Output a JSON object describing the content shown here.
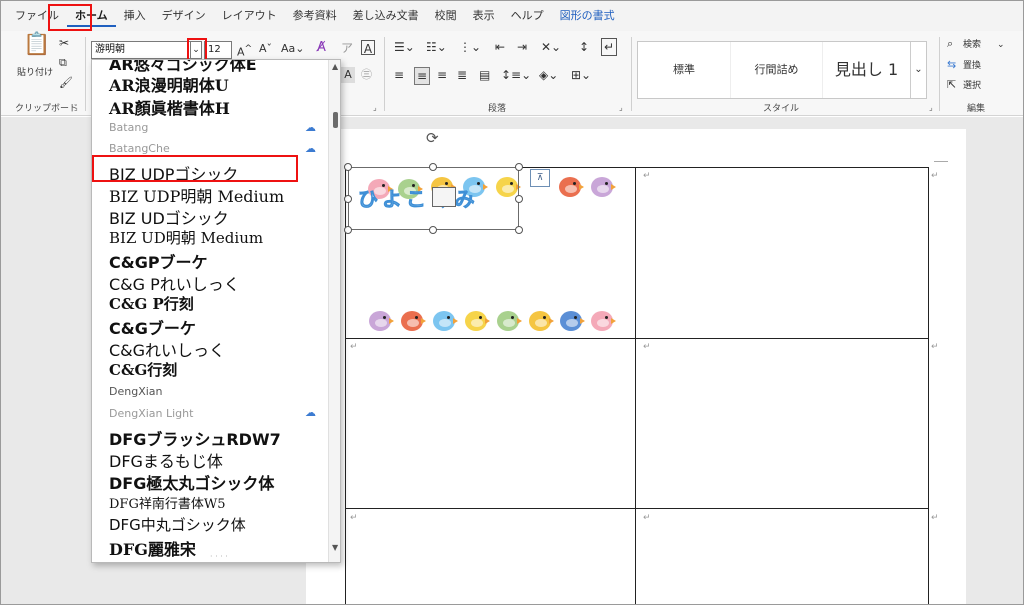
{
  "tabs": [
    "ファイル",
    "ホーム",
    "挿入",
    "デザイン",
    "レイアウト",
    "参考資料",
    "差し込み文書",
    "校閲",
    "表示",
    "ヘルプ",
    "図形の書式"
  ],
  "clipboard": {
    "paste_label": "貼り付け",
    "group_label": "クリップボード"
  },
  "font": {
    "name": "游明朝",
    "size": "12",
    "dropdown_arrow": "⌄"
  },
  "paragraph": {
    "group_label": "段落"
  },
  "styles": {
    "items": [
      "標準",
      "行間詰め",
      "見出し 1"
    ],
    "group_label": "スタイル"
  },
  "editing": {
    "search_label": "検索",
    "replace_label": "置換",
    "select_label": "選択",
    "group_label": "編集"
  },
  "font_list": [
    {
      "name": "AR悠々ゴシック体E",
      "cloud": false,
      "style": "partial"
    },
    {
      "name": "AR浪漫明朝体U",
      "cloud": false,
      "style": "bold"
    },
    {
      "name": "AR顏眞楷書体H",
      "cloud": false,
      "style": "bold"
    },
    {
      "name": "Batang",
      "cloud": true,
      "style": "faint"
    },
    {
      "name": "BatangChe",
      "cloud": true,
      "style": "faint"
    },
    {
      "name": "BIZ UDPゴシック",
      "cloud": false,
      "style": "normal"
    },
    {
      "name": "BIZ UDP明朝 Medium",
      "cloud": false,
      "style": "serif"
    },
    {
      "name": "BIZ UDゴシック",
      "cloud": false,
      "style": "normal"
    },
    {
      "name": "BIZ UD明朝 Medium",
      "cloud": false,
      "style": "serif"
    },
    {
      "name": "C&GPブーケ",
      "cloud": false,
      "style": "bold"
    },
    {
      "name": "C&G Pれいしっく",
      "cloud": false,
      "style": "normal"
    },
    {
      "name": "C&G P行刻",
      "cloud": false,
      "style": "bold"
    },
    {
      "name": "C&Gブーケ",
      "cloud": false,
      "style": "bold"
    },
    {
      "name": "C&Gれいしっく",
      "cloud": false,
      "style": "normal"
    },
    {
      "name": "C&G行刻",
      "cloud": false,
      "style": "bold"
    },
    {
      "name": "DengXian",
      "cloud": false,
      "style": "small"
    },
    {
      "name": "DengXian Light",
      "cloud": true,
      "style": "faint"
    },
    {
      "name": "DFGブラッシュRDW7",
      "cloud": false,
      "style": "bold"
    },
    {
      "name": "DFGまるもじ体",
      "cloud": false,
      "style": "normal"
    },
    {
      "name": "DFG極太丸ゴシック体",
      "cloud": false,
      "style": "heavy"
    },
    {
      "name": "DFG祥南行書体W5",
      "cloud": false,
      "style": "serif"
    },
    {
      "name": "DFG中丸ゴシック体",
      "cloud": false,
      "style": "normal"
    },
    {
      "name": "DFG麗雅宋",
      "cloud": false,
      "style": "bold"
    }
  ],
  "document": {
    "textbox_text": "ひよこぐみ",
    "return_mark": "↵"
  },
  "colors": {
    "highlight": "#e11111",
    "accent": "#1f5fbf",
    "bird_colors": [
      "#f4a9b8",
      "#f5c542",
      "#7cc5f0",
      "#f6d44a",
      "#ea6f4f",
      "#c9a6d8",
      "#a9d18e",
      "#5b8fd6"
    ]
  }
}
